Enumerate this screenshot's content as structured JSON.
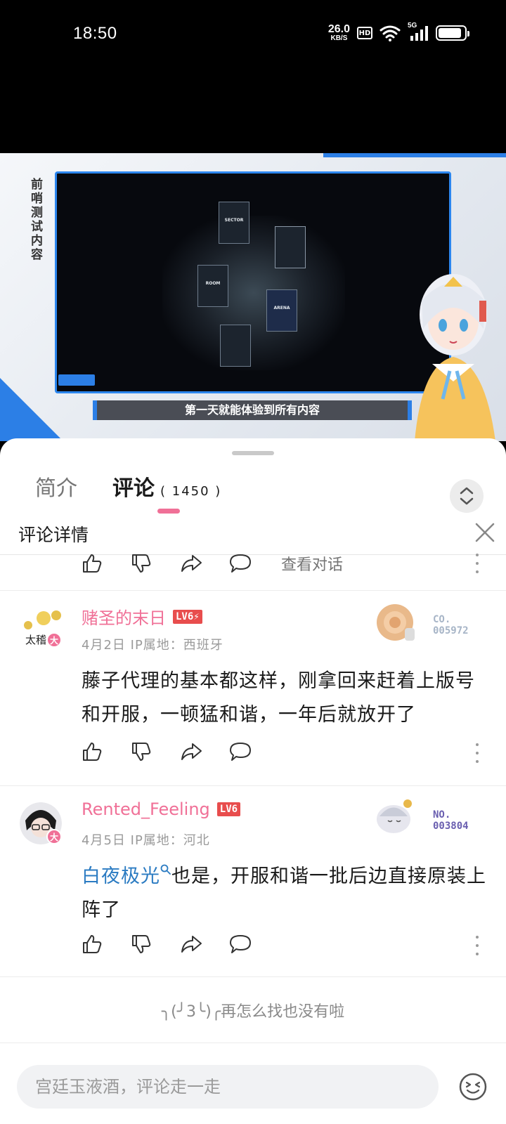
{
  "status_bar": {
    "time": "18:50",
    "net_speed": "26.0",
    "net_unit": "KB/S",
    "hd": "HD",
    "signal": "5G",
    "battery_level": 0.9
  },
  "video": {
    "side_title": "前哨测试内容",
    "subtitle": "第一天就能体验到所有内容",
    "game_cards": [
      "SECTOR",
      "ROOM",
      "ARENA"
    ]
  },
  "tabs": {
    "intro": "简介",
    "comments": "评论",
    "comments_count": "( 1450 )"
  },
  "detail": {
    "title": "评论详情"
  },
  "prev_actions": {
    "view_conversation": "查看对话"
  },
  "comments": [
    {
      "username": "赌圣的末日",
      "level": "LV6⚡",
      "avatar_caption": "太稽",
      "big_member": "大",
      "date": "4月2日",
      "ip": "IP属地：西班牙",
      "text": "藤子代理的基本都这样，刚拿回来赶着上版号和开服，一顿猛和谐，一年后就放开了",
      "fan_no_label": "CO.",
      "fan_no": "005972",
      "fan_color": "#a7b5c7"
    },
    {
      "username": "Rented_Feeling",
      "level": "LV6",
      "big_member": "大",
      "date": "4月5日",
      "ip": "IP属地：河北",
      "mention": "白夜极光",
      "text": "也是，开服和谐一批后边直接原装上阵了",
      "fan_no_label": "NO.",
      "fan_no": "003804",
      "fan_color": "#6a5fb0"
    }
  ],
  "end_text": "╮(╯3╰)╭再怎么找也没有啦",
  "input": {
    "placeholder": "宫廷玉液酒，评论走一走"
  },
  "colors": {
    "accent": "#f07097",
    "mention": "#2b7bc2",
    "video_frame": "#2c86ee"
  }
}
